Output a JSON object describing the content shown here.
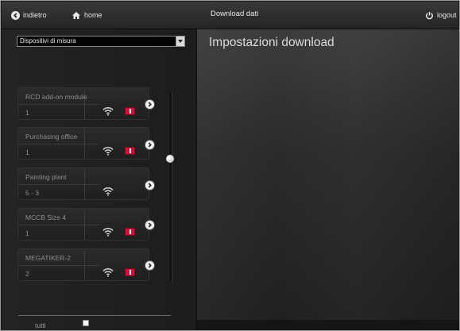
{
  "topbar": {
    "back_label": "indietro",
    "home_label": "home",
    "title": "Download dati",
    "logout_label": "logout"
  },
  "device_select": {
    "selected": "Dispositivi di misura"
  },
  "main": {
    "heading": "Impostazioni download"
  },
  "devices": [
    {
      "name": "RCD add-on module",
      "count": "1",
      "alert": true
    },
    {
      "name": "Purchasing office",
      "count": "1",
      "alert": true
    },
    {
      "name": "Painting plant",
      "count": "5 - 3",
      "alert": false
    },
    {
      "name": "MCCB Size 4",
      "count": "1",
      "alert": true
    },
    {
      "name": "MEGATIKER-2",
      "count": "2",
      "alert": true
    }
  ],
  "footer": {
    "all_label": "tutti",
    "all_checked": false
  },
  "colors": {
    "alert": "#d0123a",
    "accent_text": "#dcdcdc"
  }
}
